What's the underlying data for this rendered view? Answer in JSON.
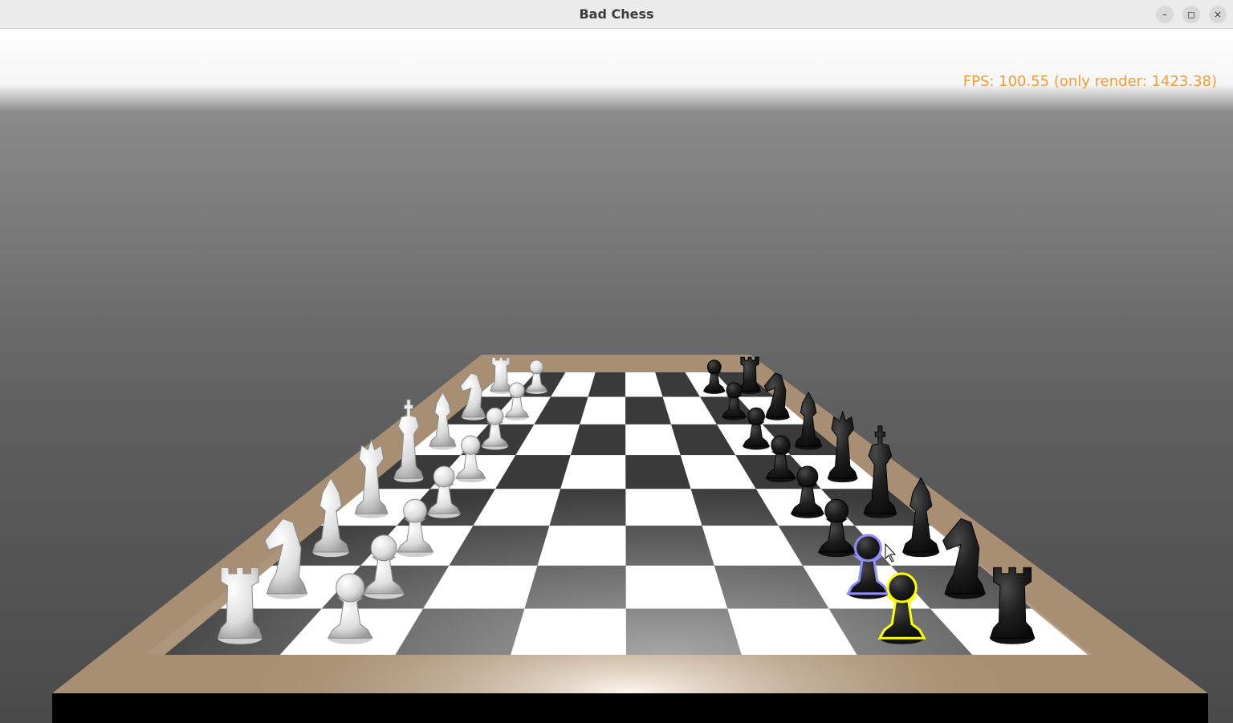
{
  "window": {
    "title": "Bad Chess",
    "controls": {
      "minimize": "–",
      "maximize": "◻",
      "close": "×"
    }
  },
  "hud": {
    "fps_text": "FPS: 100.55 (only render: 1423.38)"
  },
  "colors": {
    "fps_text": "#f39c34",
    "board_frame": "#a88e72",
    "light_square": "#ffffff",
    "dark_square": "#3a3a3a",
    "white_pieces": "#e6e6e6",
    "black_pieces": "#1e1e1e",
    "hover_outline": "#8f8fff",
    "selected_outline": "#ffff00"
  },
  "board": {
    "files": 8,
    "ranks": 8
  },
  "pieces": {
    "white": [
      "rook",
      "knight",
      "bishop",
      "king",
      "queen",
      "bishop",
      "knight",
      "rook",
      "pawn",
      "pawn",
      "pawn",
      "pawn",
      "pawn",
      "pawn",
      "pawn",
      "pawn"
    ],
    "black": [
      "rook",
      "knight",
      "bishop",
      "king",
      "queen",
      "bishop",
      "knight",
      "rook",
      "pawn",
      "pawn",
      "pawn",
      "pawn",
      "pawn",
      "pawn",
      "pawn",
      "pawn"
    ],
    "hovered": "black-pawn-b7",
    "selected": "black-pawn-a7"
  }
}
